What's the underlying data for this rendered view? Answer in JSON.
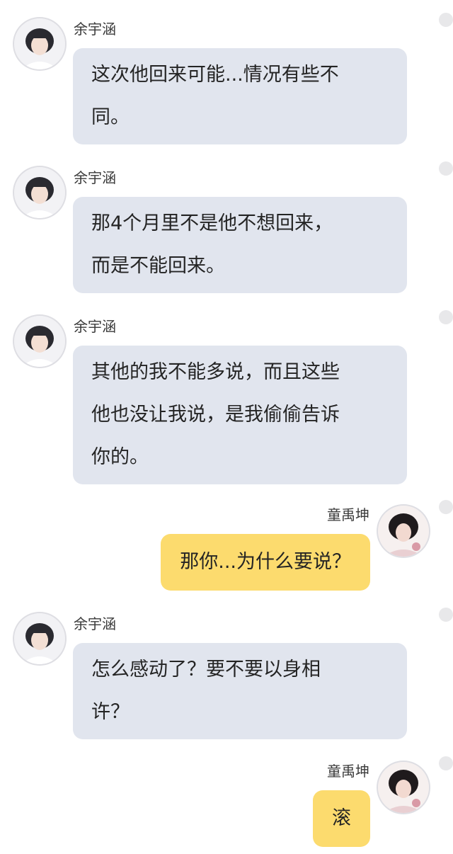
{
  "chat": {
    "messages": [
      {
        "side": "left",
        "sender": "余宇涵",
        "lines": [
          "这次他回来可能...情况有些不",
          "同。"
        ]
      },
      {
        "side": "left",
        "sender": "余宇涵",
        "lines": [
          "那4个月里不是他不想回来，",
          "而是不能回来。"
        ]
      },
      {
        "side": "left",
        "sender": "余宇涵",
        "lines": [
          "其他的我不能多说，而且这些",
          "他也没让我说，是我偷偷告诉",
          "你的。"
        ]
      },
      {
        "side": "right",
        "sender": "童禹坤",
        "lines": [
          "那你...为什么要说？"
        ]
      },
      {
        "side": "left",
        "sender": "余宇涵",
        "lines": [
          "怎么感动了？要不要以身相",
          "许？"
        ]
      },
      {
        "side": "right",
        "sender": "童禹坤",
        "lines": [
          "滚"
        ]
      }
    ]
  },
  "colors": {
    "incoming_bubble": "#e1e5ee",
    "outgoing_bubble": "#fcdb6e",
    "background": "#ffffff"
  }
}
